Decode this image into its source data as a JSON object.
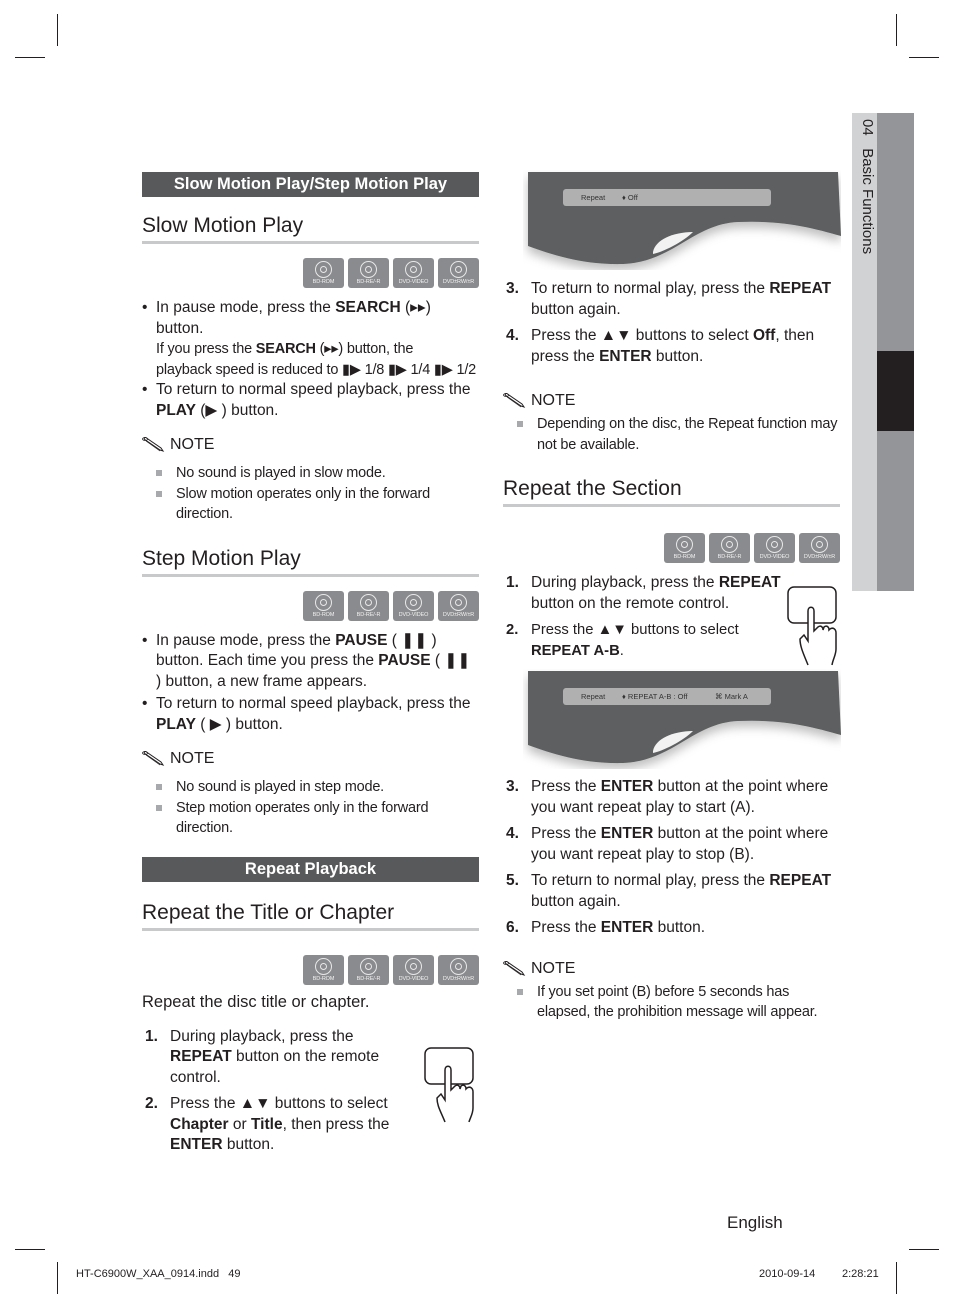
{
  "side_tab": {
    "chapter_number": "04",
    "chapter_title": "Basic Functions"
  },
  "disc_types": [
    "BD-ROM",
    "BD-RE/-R",
    "DVD-VIDEO",
    "DVD±RW/±R"
  ],
  "left": {
    "section_bar_1": "Slow Motion Play/Step Motion Play",
    "slow_motion": {
      "heading": "Slow Motion Play",
      "bullets": [
        {
          "line_a_pre": "In pause mode, press the ",
          "line_a_bold": "SEARCH",
          "line_a_post": " (▸▸)",
          "line_b": "button.",
          "sub_pre": "If you press the ",
          "sub_bold": "SEARCH",
          "sub_post": " (▸▸) button, the",
          "sub_line2": "playback speed is reduced to ▮▶ 1/8 ▮▶ 1/4 ▮▶ 1/2"
        },
        {
          "pre": "To return to normal speed playback, press the ",
          "bold": "PLAY",
          "post": " (▶ ) button."
        }
      ],
      "note_title": "NOTE",
      "notes": [
        "No sound is played in slow mode.",
        "Slow motion operates only in the forward direction."
      ]
    },
    "step_motion": {
      "heading": "Step Motion Play",
      "bullets": [
        {
          "pre1": "In pause mode, press the ",
          "bold1": "PAUSE",
          "post1": " ( ❚❚ ) button.",
          "pre2": " Each time you press the ",
          "bold2": "PAUSE",
          "post2": " ( ❚❚ ) button, a new frame appears."
        },
        {
          "pre": "To return to normal speed playback, press the ",
          "bold": "PLAY",
          "post": " ( ▶ ) button."
        }
      ],
      "note_title": "NOTE",
      "notes": [
        "No sound is played in step mode.",
        "Step motion operates only in the forward direction."
      ]
    },
    "section_bar_2": "Repeat Playback",
    "repeat_title": {
      "heading": "Repeat the Title or Chapter",
      "intro": "Repeat the disc title or chapter.",
      "steps": [
        {
          "num": "1.",
          "pre": "During playback, press the ",
          "bold": "REPEAT",
          "post": " button on the remote control."
        },
        {
          "num": "2.",
          "pre": "Press the ▲▼ buttons to select ",
          "bold": "Chapter",
          "mid": " or ",
          "bold2": "Title",
          "mid2": ", then press the ",
          "bold3": "ENTER",
          "post": " button."
        }
      ]
    }
  },
  "right": {
    "osd_1": {
      "label": "Repeat",
      "value": "♦ Off"
    },
    "steps_a": [
      {
        "num": "3.",
        "pre": "To return to normal play, press the ",
        "bold": "REPEAT",
        "post": " button again."
      },
      {
        "num": "4.",
        "pre": "Press the ▲▼ buttons to select ",
        "bold": "Off",
        "mid": ", then press the ",
        "bold2": "ENTER",
        "post": " button."
      }
    ],
    "note_title_1": "NOTE",
    "notes_1": [
      "Depending on the disc, the Repeat function may not be available."
    ],
    "repeat_section": {
      "heading": "Repeat the Section",
      "steps_b": [
        {
          "num": "1.",
          "pre": "During playback, press the ",
          "bold": "REPEAT",
          "post": " button on the remote control."
        },
        {
          "num": "2.",
          "pre": "Press the ▲▼ buttons to select ",
          "bold": "REPEAT A-B",
          "post": "."
        }
      ],
      "osd_2": {
        "label": "Repeat",
        "value": "♦ REPEAT A-B : Off",
        "action": "Mark A"
      },
      "steps_c": [
        {
          "num": "3.",
          "pre": "Press the ",
          "bold": "ENTER",
          "post": " button at the point where you want repeat play to start (A)."
        },
        {
          "num": "4.",
          "pre": "Press the ",
          "bold": "ENTER",
          "post": " button at the point where you want repeat play to stop (B)."
        },
        {
          "num": "5.",
          "pre": "To return to normal play, press the ",
          "bold": "REPEAT",
          "post": " button again."
        },
        {
          "num": "6.",
          "pre": "Press the ",
          "bold": "ENTER",
          "post": " button."
        }
      ],
      "note_title": "NOTE",
      "notes": [
        "If you set point (B) before 5 seconds has elapsed, the prohibition message will appear."
      ]
    }
  },
  "footer": {
    "language": "English",
    "slug_file": "HT-C6900W_XAA_0914.indd   49",
    "slug_date": "2010-09-14",
    "slug_time": "2:28:21"
  }
}
